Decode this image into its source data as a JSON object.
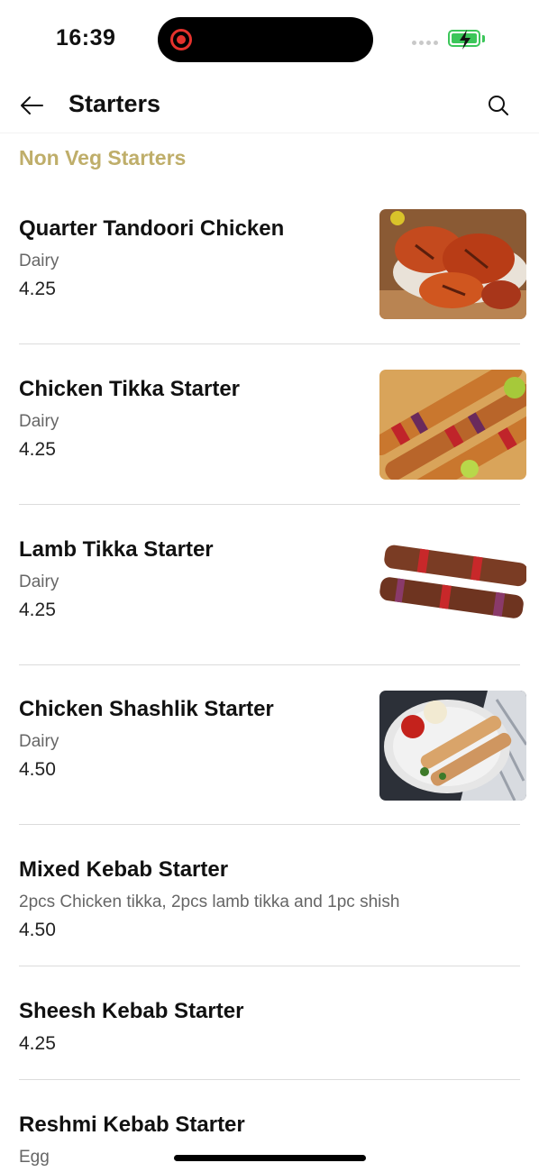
{
  "status_bar": {
    "time": "16:39"
  },
  "header": {
    "title": "Starters"
  },
  "section": {
    "title": "Non Veg Starters"
  },
  "items": [
    {
      "name": "Quarter Tandoori Chicken",
      "desc": "Dairy",
      "price": "4.25",
      "image": "tandoori-chicken-photo"
    },
    {
      "name": "Chicken Tikka Starter",
      "desc": "Dairy",
      "price": "4.25",
      "image": "chicken-tikka-skewers-photo"
    },
    {
      "name": "Lamb Tikka Starter",
      "desc": "Dairy",
      "price": "4.25",
      "image": "lamb-tikka-skewers-photo"
    },
    {
      "name": "Chicken Shashlik Starter",
      "desc": "Dairy",
      "price": "4.50",
      "image": "chicken-shashlik-plate-photo"
    },
    {
      "name": "Mixed Kebab Starter",
      "desc": "2pcs Chicken tikka, 2pcs lamb tikka and 1pc shish",
      "price": "4.50"
    },
    {
      "name": "Sheesh Kebab Starter",
      "price": "4.25"
    },
    {
      "name": "Reshmi Kebab Starter",
      "desc": "Egg"
    }
  ],
  "colors": {
    "accent": "#bfae6a",
    "recording": "#e5322d",
    "battery": "#3cc65a"
  }
}
